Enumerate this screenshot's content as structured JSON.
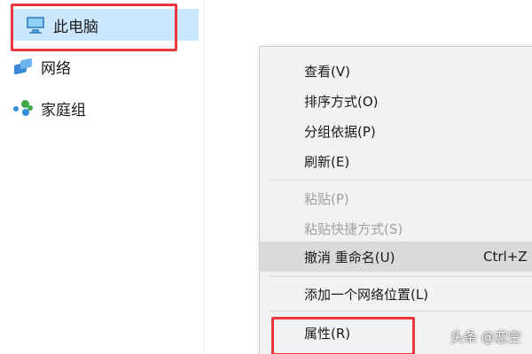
{
  "nav": {
    "items": [
      {
        "label": "此电脑",
        "icon": "computer-icon"
      },
      {
        "label": "网络",
        "icon": "network-icon"
      },
      {
        "label": "家庭组",
        "icon": "homegroup-icon"
      }
    ]
  },
  "context_menu": {
    "items": [
      {
        "label": "查看(V)",
        "submenu": true
      },
      {
        "label": "排序方式(O)",
        "submenu": true
      },
      {
        "label": "分组依据(P)",
        "submenu": true
      },
      {
        "label": "刷新(E)"
      },
      {
        "label": "粘贴(P)",
        "disabled": true
      },
      {
        "label": "粘贴快捷方式(S)",
        "disabled": true
      },
      {
        "label": "撤消 重命名(U)",
        "shortcut": "Ctrl+Z",
        "highlighted": true
      },
      {
        "label": "添加一个网络位置(L)"
      },
      {
        "label": "属性(R)"
      }
    ],
    "submenu_arrow": "›"
  },
  "watermark": "头条 @恋空",
  "colors": {
    "highlight_box": "#e8383d",
    "selected_nav_bg": "#cce8ff",
    "menu_bg": "#f2f2f2",
    "menu_hover_bg": "#dadada",
    "disabled_text": "#a0a0a0"
  }
}
